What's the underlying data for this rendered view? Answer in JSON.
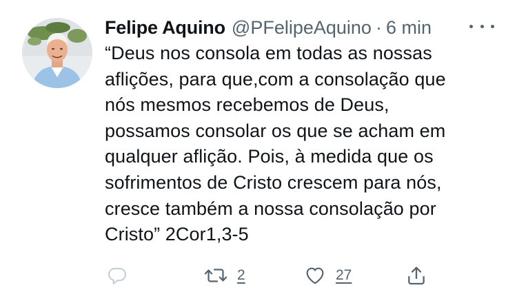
{
  "tweet": {
    "author": {
      "display_name": "Felipe Aquino",
      "handle": "@PFelipeAquino",
      "separator": "·",
      "time": "6 min"
    },
    "text_lines": [
      "“Deus nos consola em todas as nossas",
      "aflições, para que,com a consolação que",
      "nós mesmos recebemos de Deus,",
      "possamos consolar os que se acham em",
      "qualquer aflição. Pois, à medida que os",
      "sofrimentos de Cristo crescem para nós,",
      "cresce também a nossa consolação por",
      "Cristo” 2Cor1,3-5"
    ],
    "actions": {
      "reply": {
        "icon": "reply-icon",
        "count": ""
      },
      "retweet": {
        "icon": "retweet-icon",
        "count": "2"
      },
      "like": {
        "icon": "heart-icon",
        "count": "27"
      },
      "share": {
        "icon": "share-icon"
      }
    },
    "more_icon": "more-options-icon"
  },
  "colors": {
    "text_primary": "#0f1419",
    "text_secondary": "#536471",
    "reply_icon": "#c4cfd6",
    "background": "#ffffff"
  }
}
